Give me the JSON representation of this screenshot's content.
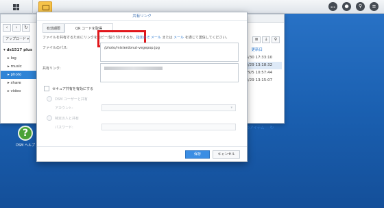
{
  "taskbar": {
    "icons": [
      "comment-icon",
      "user-icon",
      "search-icon",
      "widget-icon"
    ]
  },
  "file_station": {
    "toolbar": {
      "upload_label": "アップロード ▾"
    },
    "tree": {
      "root": "▾ ds1517 plus",
      "items": [
        "▸ log",
        "▸ music",
        "▸ photo",
        "▸ share",
        "▸ video"
      ],
      "selected_index": 2
    },
    "columns": {
      "date_header": "更新日"
    },
    "dates": [
      "7/8/30 17:33:10",
      "7/8/29 13:18:32",
      "17/9/5 10:57:44",
      "7/8/29 13:15:07"
    ],
    "item_count": "個のアイテム",
    "refresh_icon": "refresh-icon"
  },
  "desktop": {
    "help_label": "DSM ヘルプ"
  },
  "dialog": {
    "title": "共有リンク",
    "tabs": [
      "有効期限",
      "QR コードを取得"
    ],
    "description": "ファイルを共有するためにリンクをコピー/貼り付けするか、",
    "desc_link1": "指定の E メール",
    "desc_mid": " または ",
    "desc_link2": "メール",
    "desc_tail": " を通じて送信してください。",
    "file_path_label": "ファイルのパス:",
    "file_path_value": "/photo/misterdonut-vegepop.jpg",
    "share_link_label": "共有リンク:",
    "secure_label": "セキュア共有を有効にする",
    "dsm_user_label": "DSM ユーザーと共有",
    "account_label": "アカウント:",
    "specific_label": "特定の人と共有",
    "password_label": "パスワード:",
    "save_label": "保存",
    "cancel_label": "キャンセル"
  }
}
